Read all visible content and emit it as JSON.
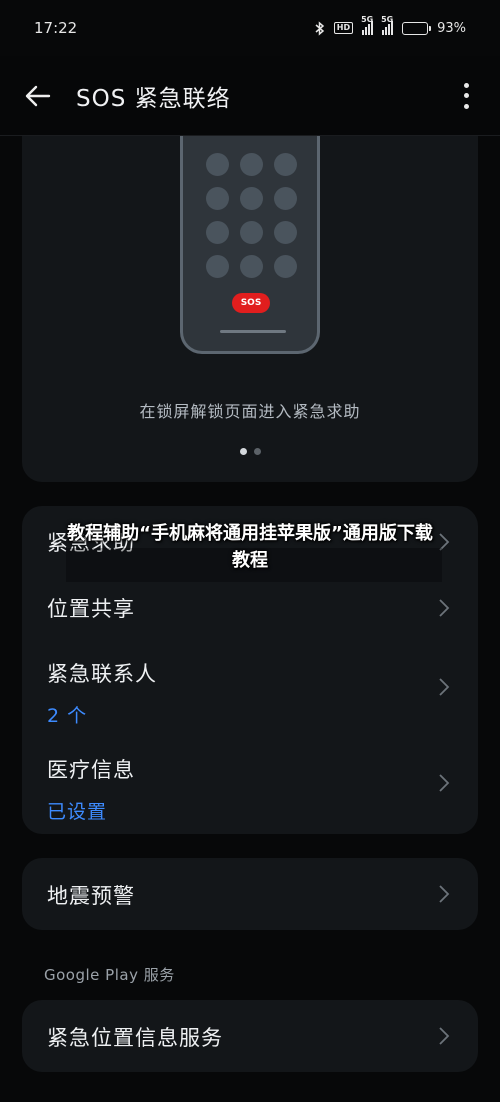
{
  "status_bar": {
    "time": "17:22",
    "bluetooth_icon": "bluetooth-icon",
    "hd_label": "HD",
    "signal1_tag": "5G",
    "signal2_tag": "5G",
    "battery_percent": "93%",
    "battery_level": 0.93
  },
  "app_bar": {
    "back_icon": "arrow-left-icon",
    "title": "SOS 紧急联络",
    "more_icon": "more-vertical-icon"
  },
  "banner": {
    "sos_label": "SOS",
    "caption": "在锁屏解锁页面进入紧急求助",
    "pages": 2,
    "active_page": 1
  },
  "emergency_card": {
    "items": [
      {
        "label": "紧急求助",
        "value": ""
      },
      {
        "label": "位置共享",
        "value": ""
      },
      {
        "label": "紧急联系人",
        "value": "2 个"
      },
      {
        "label": "医疗信息",
        "value": "已设置"
      }
    ]
  },
  "earthquake_card": {
    "label": "地震预警"
  },
  "google_section": {
    "label": "Google Play 服务",
    "item_label": "紧急位置信息服务"
  },
  "overlay_text": "教程辅助“手机麻将通用挂苹果版”通用版下载教程",
  "colors": {
    "background": "#070809",
    "card": "#131619",
    "accent_blue": "#3d8bff",
    "sos_red": "#e11e1e"
  }
}
